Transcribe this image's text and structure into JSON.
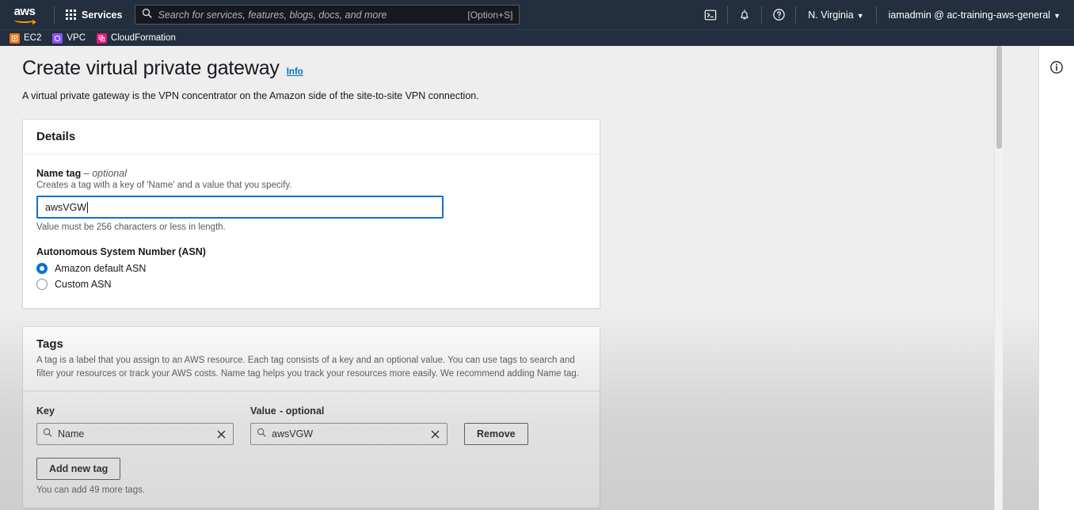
{
  "navbar": {
    "logo_text": "aws",
    "logo_name": "aws-logo",
    "services_label": "Services",
    "search": {
      "placeholder": "Search for services, features, blogs, docs, and more",
      "shortcut": "[Option+S]",
      "value": ""
    },
    "cloudshell_icon": "cloudshell-terminal-icon",
    "notifications_icon": "bell-notification-icon",
    "help_icon": "help-question-icon",
    "region": "N. Virginia",
    "account": "iamadmin @ ac-training-aws-general",
    "caret": "▼"
  },
  "shortcuts": [
    {
      "label": "EC2",
      "color": "#ec7211",
      "glyph": "⬚"
    },
    {
      "label": "VPC",
      "color": "#8c4fff",
      "glyph": "⬚"
    },
    {
      "label": "CloudFormation",
      "color": "#e7157b",
      "glyph": "⬚"
    }
  ],
  "page": {
    "title": "Create virtual private gateway",
    "info_link": "Info",
    "description": "A virtual private gateway is the VPN concentrator on the Amazon side of the site-to-site VPN connection."
  },
  "details_card": {
    "title": "Details",
    "name_tag": {
      "label": "Name tag",
      "optional_suffix": "– optional",
      "hint": "Creates a tag with a key of 'Name' and a value that you specify.",
      "value": "awsVGW",
      "footnote": "Value must be 256 characters or less in length."
    },
    "asn": {
      "legend": "Autonomous System Number (ASN)",
      "options": [
        {
          "label": "Amazon default ASN",
          "selected": true
        },
        {
          "label": "Custom ASN",
          "selected": false
        }
      ]
    }
  },
  "tags_card": {
    "title": "Tags",
    "description": "A tag is a label that you assign to an AWS resource. Each tag consists of a key and an optional value. You can use tags to search and filter your resources or track your AWS costs. Name tag helps you track your resources more easily. We recommend adding Name tag.",
    "columns": {
      "key": "Key",
      "value": "Value",
      "value_optional_suffix": "- optional"
    },
    "rows": [
      {
        "key": "Name",
        "value": "awsVGW",
        "remove_label": "Remove",
        "clear_glyph": "✕"
      }
    ],
    "add_button": "Add new tag",
    "add_note": "You can add 49 more tags."
  },
  "info_panel": {
    "icon": "info-circle-icon"
  },
  "colors": {
    "nav_bg": "#232f3e",
    "page_bg": "#eeeeee",
    "accent_blue": "#0972d3",
    "link_blue": "#0073bb",
    "aws_orange": "#ff9900"
  }
}
